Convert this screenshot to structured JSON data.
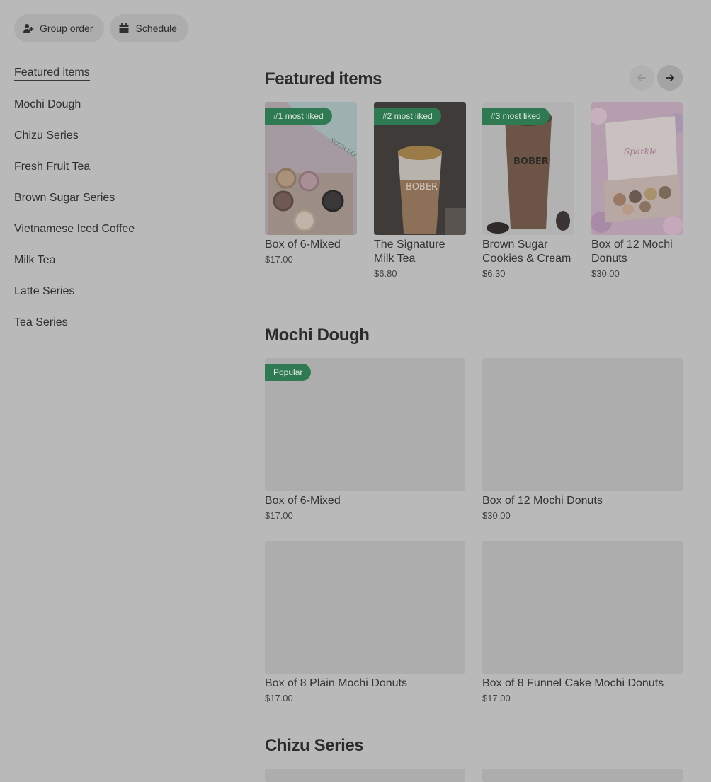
{
  "top_actions": {
    "group_order": "Group order",
    "schedule": "Schedule"
  },
  "sidebar": {
    "items": [
      {
        "label": "Featured items"
      },
      {
        "label": "Mochi Dough"
      },
      {
        "label": "Chizu Series"
      },
      {
        "label": "Fresh Fruit Tea"
      },
      {
        "label": "Brown Sugar Series"
      },
      {
        "label": "Vietnamese Iced Coffee"
      },
      {
        "label": "Milk Tea"
      },
      {
        "label": "Latte Series"
      },
      {
        "label": "Tea Series"
      }
    ]
  },
  "featured": {
    "title": "Featured items",
    "items": [
      {
        "badge": "#1 most liked",
        "name": "Box of 6-Mixed",
        "price": "$17.00"
      },
      {
        "badge": "#2 most liked",
        "name": "The Signature Milk Tea",
        "price": "$6.80"
      },
      {
        "badge": "#3 most liked",
        "name": "Brown Sugar Cookies & Cream",
        "price": "$6.30"
      },
      {
        "badge": "",
        "name": "Box of 12 Mochi Donuts",
        "price": "$30.00"
      }
    ],
    "image_text": {
      "card1_box_text": "YOUR DONUT",
      "card2_cup_text": "BOBER",
      "card3_cup_text": "BOBER",
      "card4_box_text": "Sparkle"
    }
  },
  "mochi_dough": {
    "title": "Mochi Dough",
    "items": [
      {
        "badge": "Popular",
        "name": "Box of 6-Mixed",
        "price": "$17.00"
      },
      {
        "badge": "",
        "name": "Box of 12 Mochi Donuts",
        "price": "$30.00"
      },
      {
        "badge": "",
        "name": "Box of 8 Plain Mochi Donuts",
        "price": "$17.00"
      },
      {
        "badge": "",
        "name": "Box of 8 Funnel Cake Mochi Donuts",
        "price": "$17.00"
      }
    ]
  },
  "chizu": {
    "title": "Chizu Series"
  },
  "colors": {
    "accent_badge": "#2f7a52",
    "overlay": "#b9b9b9"
  }
}
